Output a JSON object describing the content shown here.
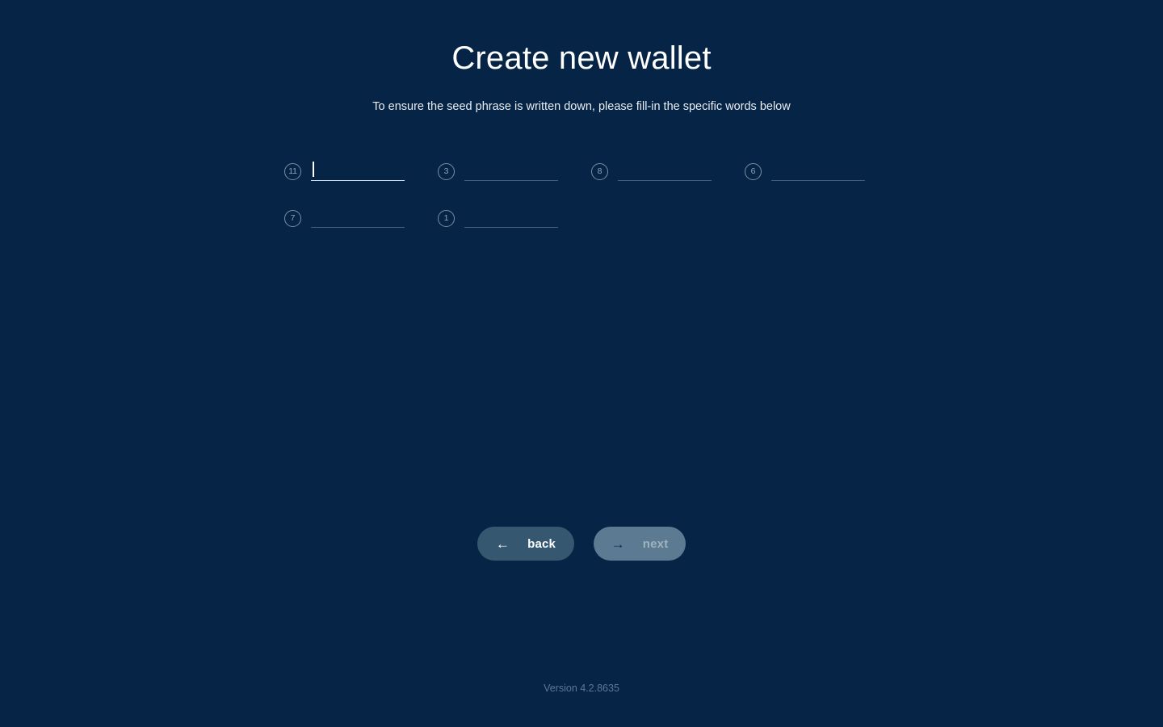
{
  "window": {
    "background_color": "#062446"
  },
  "header": {
    "title": "Create new wallet",
    "subtitle": "To ensure the seed phrase is written down, please fill-in the specific words below"
  },
  "seed_verification": {
    "fields": [
      {
        "index_label": "11",
        "value": "",
        "focused": true
      },
      {
        "index_label": "3",
        "value": "",
        "focused": false
      },
      {
        "index_label": "8",
        "value": "",
        "focused": false
      },
      {
        "index_label": "6",
        "value": "",
        "focused": false
      },
      {
        "index_label": "7",
        "value": "",
        "focused": false
      },
      {
        "index_label": "1",
        "value": "",
        "focused": false
      }
    ]
  },
  "footer": {
    "back_label": "back",
    "back_arrow": "←",
    "next_label": "next",
    "next_arrow": "→",
    "next_disabled": true,
    "version": "Version 4.2.8635"
  },
  "colors": {
    "background": "#062446",
    "back_button": "#35576f",
    "next_button": "#5c7a91",
    "title_text": "#ffffff",
    "version_text": "#5d7896",
    "index_circle_border": "#7a8ea4"
  }
}
